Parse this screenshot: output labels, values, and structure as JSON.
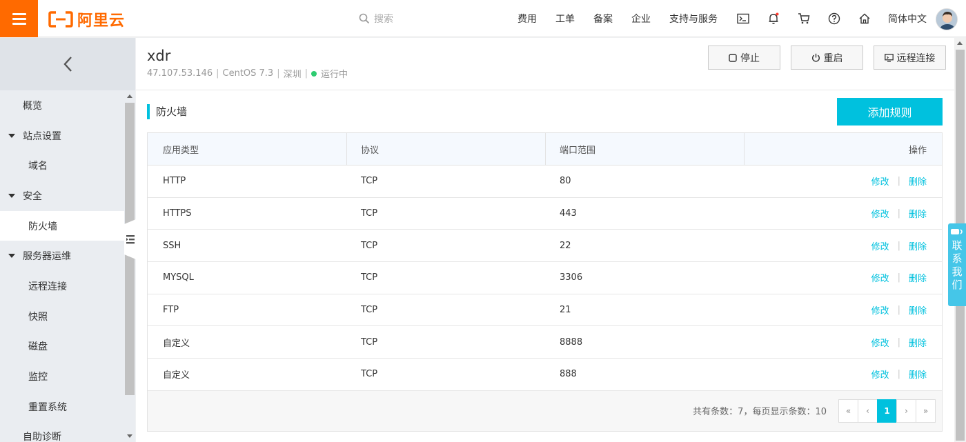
{
  "brand": {
    "name": "阿里云",
    "color": "#ff6a00"
  },
  "header": {
    "search_placeholder": "搜索",
    "nav": [
      "费用",
      "工单",
      "备案",
      "企业",
      "支持与服务"
    ],
    "icons": [
      "terminal-icon",
      "bell-icon",
      "cart-icon",
      "help-icon",
      "home-icon"
    ],
    "language": "简体中文"
  },
  "sidebar": {
    "items": [
      {
        "label": "概览",
        "kind": "top"
      },
      {
        "label": "站点设置",
        "kind": "group"
      },
      {
        "label": "域名",
        "kind": "sub"
      },
      {
        "label": "安全",
        "kind": "group"
      },
      {
        "label": "防火墙",
        "kind": "sub",
        "active": true
      },
      {
        "label": "服务器运维",
        "kind": "group"
      },
      {
        "label": "远程连接",
        "kind": "sub"
      },
      {
        "label": "快照",
        "kind": "sub"
      },
      {
        "label": "磁盘",
        "kind": "sub"
      },
      {
        "label": "监控",
        "kind": "sub"
      },
      {
        "label": "重置系统",
        "kind": "sub"
      },
      {
        "label": "自助诊断",
        "kind": "top"
      }
    ]
  },
  "instance": {
    "name": "xdr",
    "ip": "47.107.53.146",
    "os": "CentOS 7.3",
    "region": "深圳",
    "status": "运行中",
    "status_color": "#2ecc71",
    "actions": {
      "stop": "停止",
      "restart": "重启",
      "remote": "远程连接"
    }
  },
  "firewall": {
    "title": "防火墙",
    "add_button": "添加规则",
    "columns": [
      "应用类型",
      "协议",
      "端口范围",
      "操作"
    ],
    "rows": [
      {
        "app": "HTTP",
        "protocol": "TCP",
        "port": "80"
      },
      {
        "app": "HTTPS",
        "protocol": "TCP",
        "port": "443"
      },
      {
        "app": "SSH",
        "protocol": "TCP",
        "port": "22"
      },
      {
        "app": "MYSQL",
        "protocol": "TCP",
        "port": "3306"
      },
      {
        "app": "FTP",
        "protocol": "TCP",
        "port": "21"
      },
      {
        "app": "自定义",
        "protocol": "TCP",
        "port": "8888"
      },
      {
        "app": "自定义",
        "protocol": "TCP",
        "port": "888"
      }
    ],
    "edit_label": "修改",
    "delete_label": "删除",
    "pager_info": "共有条数：7，每页显示条数：10",
    "pager": {
      "first": "«",
      "prev": "‹",
      "current": "1",
      "next": "›",
      "last": "»"
    }
  },
  "contact": {
    "label": "联系我们"
  },
  "accent": "#00c1de"
}
